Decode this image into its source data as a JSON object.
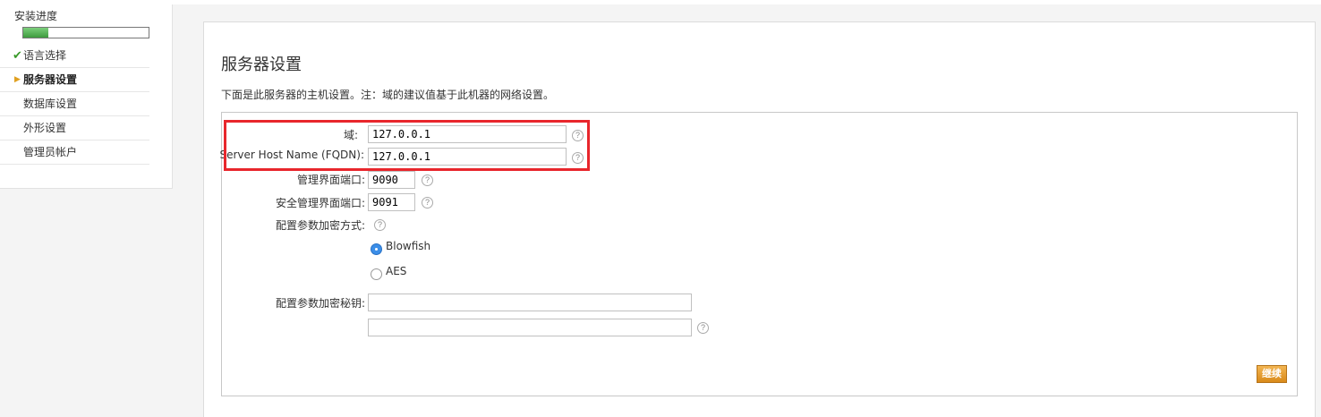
{
  "sidebar": {
    "title": "安装进度",
    "progress_fraction": 0.2,
    "items": [
      {
        "label": "语言选择",
        "status": "done",
        "icon": "check-icon"
      },
      {
        "label": "服务器设置",
        "status": "current",
        "icon": "arrow-right-icon"
      },
      {
        "label": "数据库设置",
        "status": "pending"
      },
      {
        "label": "外形设置",
        "status": "pending"
      },
      {
        "label": "管理员帐户",
        "status": "pending"
      }
    ]
  },
  "main": {
    "title": "服务器设置",
    "description": "下面是此服务器的主机设置。注：域的建议值基于此机器的网络设置。",
    "fields": {
      "domain": {
        "label": "域:",
        "value": "127.0.0.1"
      },
      "fqdn": {
        "label": "Server Host Name (FQDN):",
        "value": "127.0.0.1"
      },
      "admin_port": {
        "label": "管理界面端口:",
        "value": "9090"
      },
      "secure_admin_port": {
        "label": "安全管理界面端口:",
        "value": "9091"
      },
      "encryption_method": {
        "label": "配置参数加密方式:",
        "options": [
          {
            "label": "Blowfish",
            "selected": true
          },
          {
            "label": "AES",
            "selected": false
          }
        ]
      },
      "encryption_key": {
        "label": "配置参数加密秘钥:",
        "value": "",
        "confirm_value": ""
      }
    },
    "help_glyph": "?",
    "continue_label": "继续"
  },
  "colors": {
    "highlight": "#e8262c",
    "accent_button": "#e49a2a",
    "progress": "#4caf50",
    "radio_selected": "#3b8ee8"
  }
}
